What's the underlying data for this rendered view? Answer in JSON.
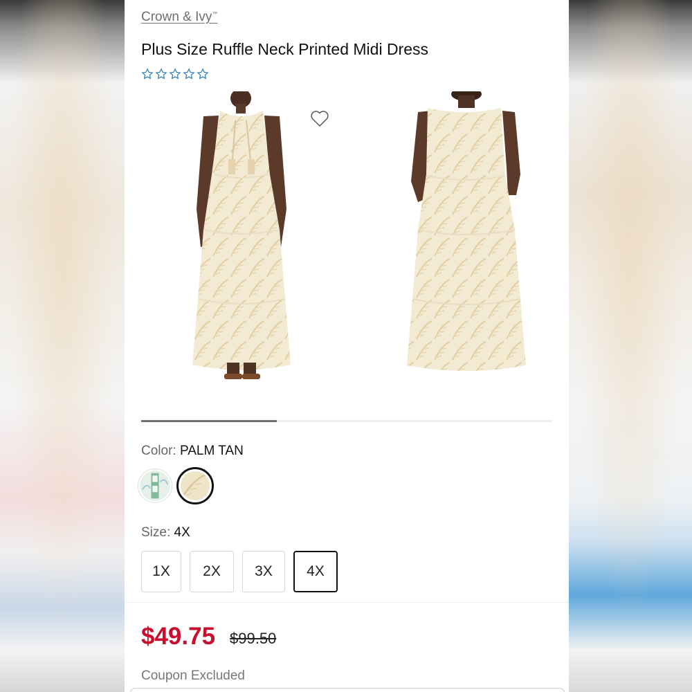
{
  "product": {
    "brand": "Crown & Ivy",
    "brand_mark": "™",
    "title": "Plus Size Ruffle Neck Printed Midi Dress",
    "rating_stars": 0,
    "rating_max": 5
  },
  "gallery": {
    "images": [
      "dress-front-image",
      "dress-back-image"
    ],
    "carousel_progress": 0.33
  },
  "color": {
    "label": "Color:",
    "selected": "PALM TAN",
    "swatches": [
      "green-print",
      "palm-tan"
    ]
  },
  "size": {
    "label": "Size:",
    "selected": "4X",
    "options": [
      "1X",
      "2X",
      "3X",
      "4X"
    ]
  },
  "pricing": {
    "sale_price": "$49.75",
    "original_price": "$99.50",
    "sale_color": "#c8102e",
    "coupon_note": "Coupon Excluded"
  },
  "colors": {
    "star_outline": "#2a7ab0",
    "text_muted": "#666666"
  }
}
